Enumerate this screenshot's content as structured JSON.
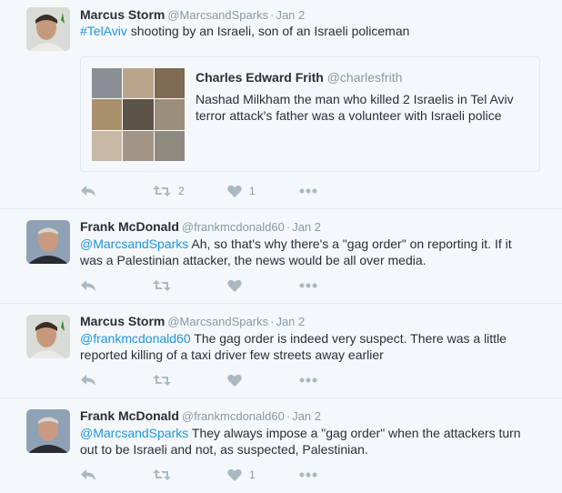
{
  "tweets": [
    {
      "name": "Marcus Storm",
      "handle": "@MarcsandSparks",
      "date": "Jan 2",
      "mention": "#TelAviv",
      "text": " shooting by an Israeli, son of an Israeli policeman",
      "retweets": "2",
      "likes": "1",
      "quote": {
        "name": "Charles Edward Frith",
        "handle": "@charlesfrith",
        "text": "Nashad Milkham the man who killed 2 Israelis in Tel Aviv terror attack's father was a volunteer with Israeli police"
      }
    },
    {
      "name": "Frank McDonald",
      "handle": "@frankmcdonald60",
      "date": "Jan 2",
      "mention": "@MarcsandSparks",
      "text": " Ah, so that's why there's a \"gag order\" on reporting it. If it was a Palestinian attacker, the news would be all over media.",
      "retweets": "",
      "likes": ""
    },
    {
      "name": "Marcus Storm",
      "handle": "@MarcsandSparks",
      "date": "Jan 2",
      "mention": "@frankmcdonald60",
      "text": " The gag order is indeed very suspect. There was a little reported killing of a taxi driver few streets away earlier",
      "retweets": "",
      "likes": ""
    },
    {
      "name": "Frank McDonald",
      "handle": "@frankmcdonald60",
      "date": "Jan 2",
      "mention": "@MarcsandSparks",
      "text": " They always impose a \"gag order\" when the attackers turn out to be Israeli and not, as suspected, Palestinian.",
      "retweets": "",
      "likes": "1"
    }
  ],
  "icons": {
    "reply": "reply-icon",
    "retweet": "retweet-icon",
    "like": "heart-icon",
    "more": "more-icon"
  },
  "colors": {
    "link": "#1b95e0",
    "muted": "#8899a6",
    "icon": "#aab8c2",
    "background": "#f5f8fa"
  },
  "separator": "·"
}
